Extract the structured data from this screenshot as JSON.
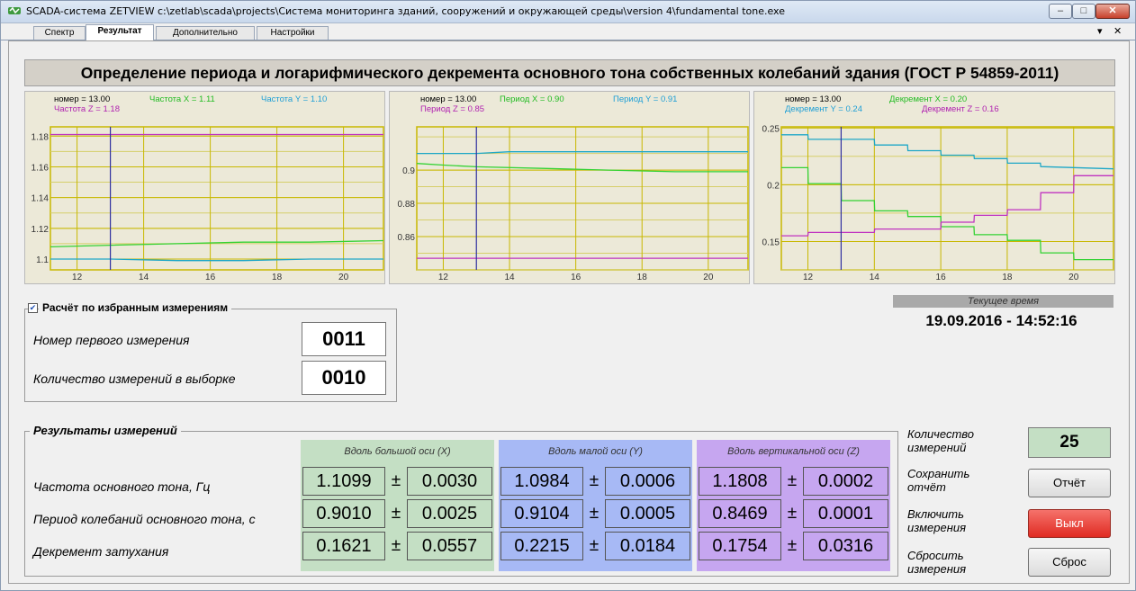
{
  "window": {
    "title": "SCADA-система ZETVIEW c:\\zetlab\\scada\\projects\\Система мониторинга зданий, сооружений и окружающей среды\\version 4\\fundamental tone.exe",
    "min_icon": "minimize-icon",
    "max_icon": "maximize-icon",
    "close_icon": "close-icon",
    "min_glyph": "–",
    "max_glyph": "□",
    "close_glyph": "✕"
  },
  "tabs": [
    {
      "label": "Спектр",
      "active": false
    },
    {
      "label": "Результат",
      "active": true
    },
    {
      "label": "Дополнительно",
      "active": false
    },
    {
      "label": "Настройки",
      "active": false
    }
  ],
  "tab_controls": {
    "dropdown": "▾",
    "close": "✕"
  },
  "header": {
    "title": "Определение периода и логарифмического декремента основного тона собственных колебаний здания (ГОСТ Р 54859-2011)"
  },
  "chart_data": [
    {
      "type": "line",
      "annotations": [
        {
          "text": "номер = 13.00",
          "color": "#000000"
        },
        {
          "text": "Частота X = 1.11",
          "color": "#22bb22"
        },
        {
          "text": "Частота Y = 1.10",
          "color": "#1e9fd6"
        },
        {
          "text": "Частота Z = 1.18",
          "color": "#b021b0"
        }
      ],
      "x_ticks": [
        "12",
        "14",
        "16",
        "18",
        "20"
      ],
      "y_ticks": [
        "1.1",
        "1.12",
        "1.14",
        "1.16",
        "1.18"
      ],
      "xlim": [
        11.2,
        21.2
      ],
      "ylim": [
        1.093,
        1.186
      ],
      "cursor_x": 13,
      "series": [
        {
          "name": "X",
          "color": "#33d233",
          "x": [
            11.2,
            13,
            15,
            17,
            19,
            21.2
          ],
          "y": [
            1.108,
            1.109,
            1.11,
            1.111,
            1.111,
            1.112
          ]
        },
        {
          "name": "Y",
          "color": "#1ea7c7",
          "x": [
            11.2,
            13,
            15,
            17,
            19,
            21.2
          ],
          "y": [
            1.1,
            1.1,
            1.099,
            1.099,
            1.1,
            1.1
          ]
        },
        {
          "name": "Z",
          "color": "#c033c0",
          "x": [
            11.2,
            21.2
          ],
          "y": [
            1.181,
            1.181
          ]
        }
      ]
    },
    {
      "type": "line",
      "annotations": [
        {
          "text": "номер = 13.00",
          "color": "#000000"
        },
        {
          "text": "Период X = 0.90",
          "color": "#22bb22"
        },
        {
          "text": "Период Y = 0.91",
          "color": "#1e9fd6"
        },
        {
          "text": "Период Z = 0.85",
          "color": "#b021b0"
        }
      ],
      "x_ticks": [
        "12",
        "14",
        "16",
        "18",
        "20"
      ],
      "y_ticks": [
        "0.86",
        "0.88",
        "0.9"
      ],
      "xlim": [
        11.2,
        21.2
      ],
      "ylim": [
        0.84,
        0.926
      ],
      "cursor_x": 13,
      "series": [
        {
          "name": "X",
          "color": "#33d233",
          "x": [
            11.2,
            12,
            13,
            15,
            17,
            19,
            21.2
          ],
          "y": [
            0.904,
            0.903,
            0.902,
            0.901,
            0.9,
            0.899,
            0.899
          ]
        },
        {
          "name": "Y",
          "color": "#1ea7c7",
          "x": [
            11.2,
            13,
            14,
            21.2
          ],
          "y": [
            0.91,
            0.91,
            0.911,
            0.911
          ]
        },
        {
          "name": "Z",
          "color": "#c033c0",
          "x": [
            11.2,
            21.2
          ],
          "y": [
            0.847,
            0.847
          ]
        }
      ]
    },
    {
      "type": "line",
      "annotations": [
        {
          "text": "номер = 13.00",
          "color": "#000000"
        },
        {
          "text": "Декремент X = 0.20",
          "color": "#22bb22"
        },
        {
          "text": "Декремент Y = 0.24",
          "color": "#1e9fd6"
        },
        {
          "text": "Декремент Z = 0.16",
          "color": "#b021b0"
        }
      ],
      "x_ticks": [
        "12",
        "14",
        "16",
        "18",
        "20"
      ],
      "y_ticks": [
        "0.15",
        "0.2",
        "0.25"
      ],
      "xlim": [
        11.2,
        21.2
      ],
      "ylim": [
        0.125,
        0.251
      ],
      "cursor_x": 13,
      "series": [
        {
          "name": "X",
          "color": "#33d233",
          "x": [
            11.2,
            12,
            12.01,
            13,
            13.01,
            14,
            14.01,
            15,
            15.01,
            16,
            16.01,
            17,
            17.01,
            18,
            18.01,
            19,
            19.01,
            20,
            20.01,
            21.2
          ],
          "y": [
            0.215,
            0.215,
            0.201,
            0.201,
            0.186,
            0.186,
            0.177,
            0.177,
            0.172,
            0.172,
            0.163,
            0.163,
            0.156,
            0.156,
            0.151,
            0.151,
            0.14,
            0.14,
            0.134,
            0.134
          ]
        },
        {
          "name": "Y",
          "color": "#1ea7c7",
          "x": [
            11.2,
            12,
            12.01,
            14,
            14.01,
            15,
            15.01,
            16,
            16.01,
            17,
            17.01,
            18,
            18.01,
            19,
            19.01,
            21.2
          ],
          "y": [
            0.244,
            0.244,
            0.24,
            0.24,
            0.235,
            0.235,
            0.23,
            0.23,
            0.226,
            0.226,
            0.223,
            0.223,
            0.219,
            0.219,
            0.216,
            0.214
          ]
        },
        {
          "name": "Z",
          "color": "#c033c0",
          "x": [
            11.2,
            12,
            12.01,
            14,
            14.01,
            16,
            16.01,
            17,
            17.01,
            18,
            18.01,
            19,
            19.01,
            20,
            20.01,
            21.2
          ],
          "y": [
            0.155,
            0.155,
            0.158,
            0.158,
            0.161,
            0.161,
            0.167,
            0.167,
            0.173,
            0.173,
            0.178,
            0.178,
            0.193,
            0.193,
            0.208,
            0.208
          ]
        }
      ]
    }
  ],
  "selection": {
    "checkbox_label": "Расчёт по избранным измерениям",
    "checked": true,
    "check_glyph": "✔",
    "first_label": "Номер первого измерения",
    "first_value": "0011",
    "count_label": "Количество измерений в выборке",
    "count_value": "0010"
  },
  "time": {
    "label": "Текущее время",
    "value": "19.09.2016 - 14:52:16"
  },
  "results": {
    "title": "Результаты измерений",
    "columns": [
      {
        "label": "Вдоль большой оси (X)",
        "color": "#c4dfc4"
      },
      {
        "label": "Вдоль малой оси (Y)",
        "color": "#a7b9f5"
      },
      {
        "label": "Вдоль вертикальной оси (Z)",
        "color": "#c6a6f0"
      }
    ],
    "rows": [
      {
        "label": "Частота основного тона, Гц",
        "values": [
          [
            "1.1099",
            "0.0030"
          ],
          [
            "1.0984",
            "0.0006"
          ],
          [
            "1.1808",
            "0.0002"
          ]
        ]
      },
      {
        "label": "Период колебаний основного тона, с",
        "values": [
          [
            "0.9010",
            "0.0025"
          ],
          [
            "0.9104",
            "0.0005"
          ],
          [
            "0.8469",
            "0.0001"
          ]
        ]
      },
      {
        "label": "Декремент затухания",
        "values": [
          [
            "0.1621",
            "0.0557"
          ],
          [
            "0.2215",
            "0.0184"
          ],
          [
            "0.1754",
            "0.0316"
          ]
        ]
      }
    ],
    "pm": "±"
  },
  "controls": {
    "count_label": "Количество измерений",
    "count_value": "25",
    "save_label": "Сохранить отчёт",
    "report_button": "Отчёт",
    "enable_label": "Включить измерения",
    "off_button": "Выкл",
    "reset_label": "Сбросить измерения",
    "reset_button": "Сброс"
  }
}
